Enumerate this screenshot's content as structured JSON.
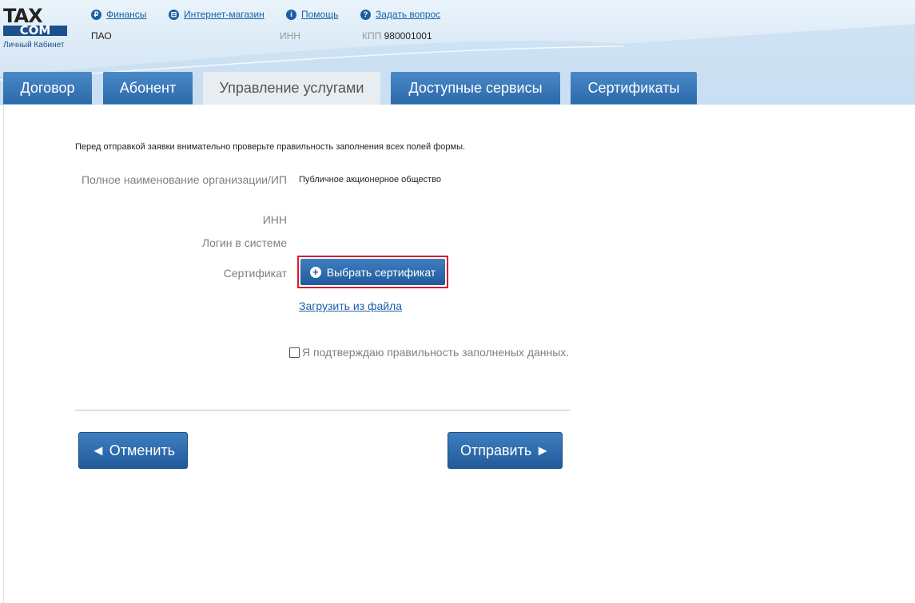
{
  "header": {
    "logo": {
      "top": "TAX",
      "bottom": "COM",
      "subtitle": "Личный Кабинет"
    },
    "links": [
      {
        "label": "Финансы",
        "icon": "ruble-icon",
        "glyph": "₽"
      },
      {
        "label": "Интернет-магазин",
        "icon": "cart-icon",
        "glyph": "⊟"
      },
      {
        "label": "Помощь",
        "icon": "info-icon",
        "glyph": "i"
      },
      {
        "label": "Задать вопрос",
        "icon": "question-icon",
        "glyph": "?"
      }
    ],
    "org_form": "ПАО",
    "inn_label": "ИНН",
    "kpp_label": "КПП",
    "kpp_value": "980001001"
  },
  "tabs": [
    {
      "label": "Договор",
      "active": false
    },
    {
      "label": "Абонент",
      "active": false
    },
    {
      "label": "Управление услугами",
      "active": true
    },
    {
      "label": "Доступные сервисы",
      "active": false
    },
    {
      "label": "Сертификаты",
      "active": false
    }
  ],
  "form": {
    "notice": "Перед отправкой заявки внимательно проверьте правильность заполнения всех полей формы.",
    "org_name_label": "Полное наименование организации/ИП",
    "org_name_value": "Публичное акционерное общество",
    "inn_label": "ИНН",
    "login_label": "Логин в системе",
    "certificate_label": "Сертификат",
    "select_cert_button": "Выбрать сертификат",
    "load_from_file_link": "Загрузить из файла",
    "confirm_checkbox_label": "Я подтверждаю правильность заполненых данных.",
    "confirm_checked": false,
    "cancel_button": "◄ Отменить",
    "submit_button": "Отправить ►"
  },
  "colors": {
    "brand_blue": "#215a9a",
    "link_blue": "#1d5fa6",
    "highlight_red": "#d0202a"
  }
}
